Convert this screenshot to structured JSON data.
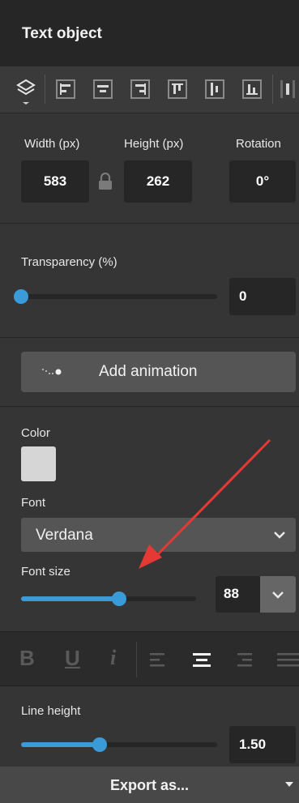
{
  "panel": {
    "title": "Text object"
  },
  "toolbar": {
    "buttons": [
      "layers-icon",
      "align-left-icon",
      "align-center-icon",
      "align-right-icon",
      "align-top-icon",
      "align-middle-icon",
      "align-bottom-icon",
      "distribute-icon"
    ]
  },
  "dimensions": {
    "width_label": "Width (px)",
    "width_value": "583",
    "height_label": "Height (px)",
    "height_value": "262",
    "rotation_label": "Rotation",
    "rotation_value": "0°"
  },
  "transparency": {
    "label": "Transparency (%)",
    "value": "0",
    "level": 0
  },
  "animation": {
    "button_label": "Add animation"
  },
  "style": {
    "color_label": "Color",
    "color_value": "#d6d6d6",
    "font_label": "Font",
    "font_value": "Verdana",
    "font_size_label": "Font size",
    "font_size_value": "88",
    "font_size_level": 0.56
  },
  "text_tools": {
    "bold": "B",
    "underline": "U",
    "italic": "i"
  },
  "line_height": {
    "label": "Line height",
    "value": "1.50",
    "level": 0.4
  },
  "footer": {
    "export_label": "Export as..."
  },
  "colors": {
    "accent": "#3a9bd8",
    "annotation_arrow": "#e53935"
  }
}
